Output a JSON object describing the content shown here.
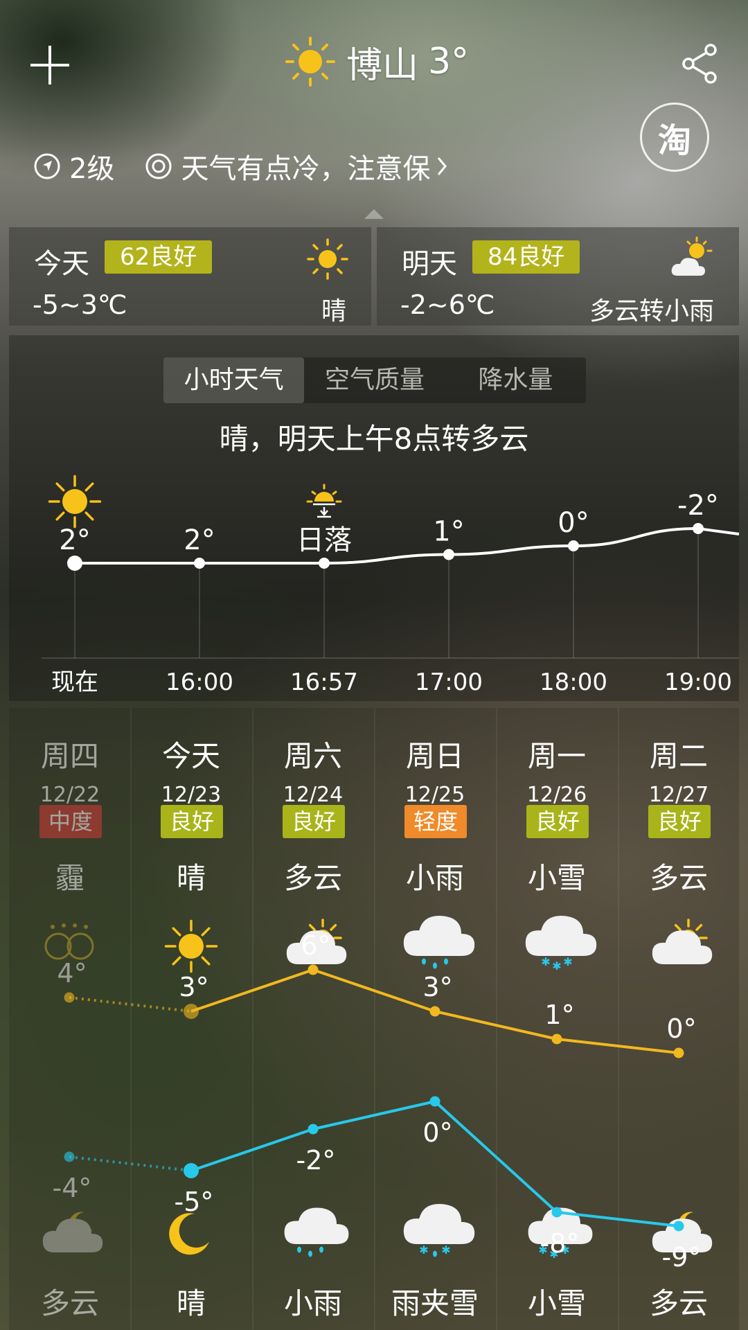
{
  "header": {
    "city": "博山",
    "temp": "3°",
    "add_icon": "plus-icon",
    "share_icon": "share-icon"
  },
  "info_row": {
    "wind": "2级",
    "tip": "天气有点冷，注意保"
  },
  "taobao": {
    "label": "淘"
  },
  "today": {
    "label": "今天",
    "aqi": "62良好",
    "range": "-5~3℃",
    "condition": "晴",
    "icon": "sun-icon"
  },
  "tomorrow": {
    "label": "明天",
    "aqi": "84良好",
    "range": "-2~6℃",
    "condition": "多云转小雨",
    "icon": "partly-cloudy-icon"
  },
  "hourly_tabs": [
    "小时天气",
    "空气质量",
    "降水量"
  ],
  "hourly_summary": "晴，明天上午8点转多云",
  "hourly": [
    {
      "time": "现在",
      "label": "2°",
      "temp": 2,
      "icon": "sun-icon"
    },
    {
      "time": "16:00",
      "label": "2°",
      "temp": 2,
      "icon": ""
    },
    {
      "time": "16:57",
      "label": "日落",
      "temp": 2,
      "icon": "sunset-icon"
    },
    {
      "time": "17:00",
      "label": "1°",
      "temp": 1,
      "icon": ""
    },
    {
      "time": "18:00",
      "label": "0°",
      "temp": 0,
      "icon": ""
    },
    {
      "time": "19:00",
      "label": "-2°",
      "temp": -2,
      "icon": ""
    }
  ],
  "daily": [
    {
      "weekday": "周四",
      "date": "12/22",
      "aqi": "中度",
      "aqi_color": "#d63a3a",
      "day_weather": "霾",
      "day_icon": "haze-icon",
      "high": 4,
      "high_label": "4°",
      "low": -4,
      "low_label": "-4°",
      "night_icon": "cloudy-moon-icon",
      "night_weather": "多云",
      "past": true
    },
    {
      "weekday": "今天",
      "date": "12/23",
      "aqi": "良好",
      "aqi_color": "#a8b41a",
      "day_weather": "晴",
      "day_icon": "sun-icon",
      "high": 3,
      "high_label": "3°",
      "low": -5,
      "low_label": "-5°",
      "night_icon": "moon-icon",
      "night_weather": "晴",
      "past": false
    },
    {
      "weekday": "周六",
      "date": "12/24",
      "aqi": "良好",
      "aqi_color": "#a8b41a",
      "day_weather": "多云",
      "day_icon": "partly-cloudy-icon",
      "high": 6,
      "high_label": "6°",
      "low": -2,
      "low_label": "-2°",
      "night_icon": "rain-moon-icon",
      "night_weather": "小雨",
      "past": false
    },
    {
      "weekday": "周日",
      "date": "12/25",
      "aqi": "轻度",
      "aqi_color": "#f08a2a",
      "day_weather": "小雨",
      "day_icon": "rain-cloud-icon",
      "high": 3,
      "high_label": "3°",
      "low": 0,
      "low_label": "0°",
      "night_icon": "sleet-cloud-icon",
      "night_weather": "雨夹雪",
      "past": false
    },
    {
      "weekday": "周一",
      "date": "12/26",
      "aqi": "良好",
      "aqi_color": "#a8b41a",
      "day_weather": "小雪",
      "day_icon": "snow-cloud-icon",
      "high": 1,
      "high_label": "1°",
      "low": -8,
      "low_label": "-8°",
      "night_icon": "snow-moon-icon",
      "night_weather": "小雪",
      "past": false
    },
    {
      "weekday": "周二",
      "date": "12/27",
      "aqi": "良好",
      "aqi_color": "#a8b41a",
      "day_weather": "多云",
      "day_icon": "partly-cloudy-icon",
      "high": 0,
      "high_label": "0°",
      "low": -9,
      "low_label": "-9°",
      "night_icon": "cloudy-moon-icon",
      "night_weather": "多云",
      "past": false
    }
  ],
  "colors": {
    "sun": "#f7c21a",
    "high_line": "#f2b81f",
    "low_line": "#27c9ea",
    "aqi_good": "#a8b41a"
  }
}
